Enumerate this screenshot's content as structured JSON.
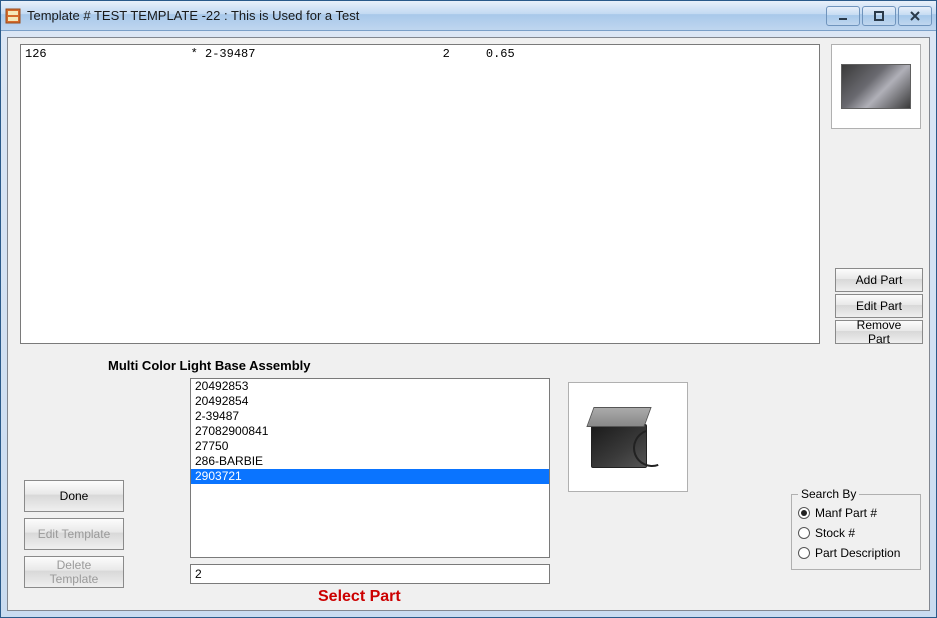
{
  "window": {
    "title": "Template # TEST TEMPLATE -22 : This is Used for a Test"
  },
  "topList": {
    "rows": [
      {
        "c1": "126",
        "c2": "* 2-39487",
        "c3": "2",
        "c4": "0.65"
      }
    ]
  },
  "rightButtons": {
    "add": "Add Part",
    "edit": "Edit Part",
    "remove": "Remove Part"
  },
  "assemblyLabel": "Multi Color Light Base Assembly",
  "partList": {
    "items": [
      "20492853",
      "20492854",
      "2-39487",
      "27082900841",
      "27750",
      "286-BARBIE",
      "2903721"
    ],
    "selectedIndex": 6
  },
  "searchInput": {
    "value": "2"
  },
  "selectPartLabel": "Select Part",
  "leftButtons": {
    "done": "Done",
    "editTemplate": "Edit Template",
    "deleteTemplate": "Delete\nTemplate"
  },
  "searchBy": {
    "legend": "Search By",
    "options": [
      "Manf Part #",
      "Stock #",
      "Part Description"
    ],
    "selectedIndex": 0
  }
}
